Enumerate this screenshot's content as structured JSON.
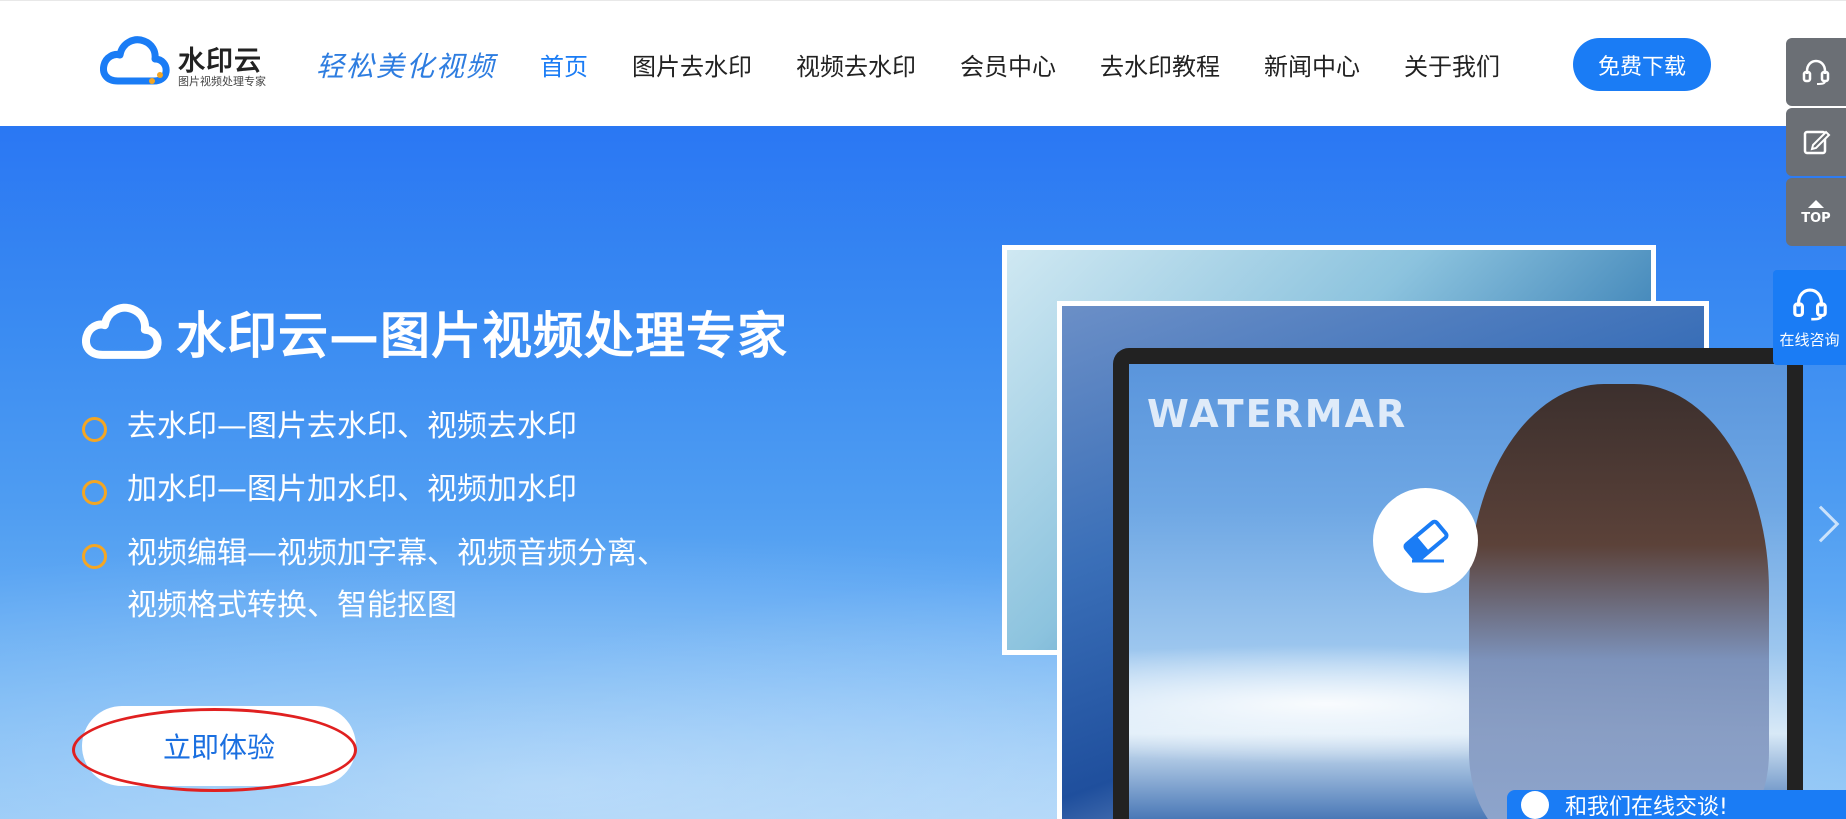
{
  "header": {
    "logo": {
      "name": "水印云",
      "subtitle": "图片视频处理专家"
    },
    "slogan": "轻松美化视频",
    "nav": [
      {
        "label": "首页",
        "active": true
      },
      {
        "label": "图片去水印",
        "active": false
      },
      {
        "label": "视频去水印",
        "active": false
      },
      {
        "label": "会员中心",
        "active": false
      },
      {
        "label": "去水印教程",
        "active": false
      },
      {
        "label": "新闻中心",
        "active": false
      },
      {
        "label": "关于我们",
        "active": false
      }
    ],
    "download_label": "免费下载"
  },
  "hero": {
    "title": "水印云—图片视频处理专家",
    "features": [
      {
        "lines": [
          "去水印—图片去水印、视频去水印"
        ]
      },
      {
        "lines": [
          "加水印—图片加水印、视频加水印"
        ]
      },
      {
        "lines": [
          "视频编辑—视频加字幕、视频音频分离、",
          "视频格式转换、智能抠图"
        ]
      }
    ],
    "cta_label": "立即体验",
    "watermark_text": "WATERMAR"
  },
  "side": {
    "top_label": "TOP",
    "consult_label": "在线咨询",
    "chat_label": "和我们在线交谈!"
  },
  "colors": {
    "brand": "#1a7cf5",
    "accent_ring": "#f4a623",
    "annotation": "#e02020"
  },
  "icons": [
    "cloud-logo-icon",
    "headset-icon",
    "edit-icon",
    "arrow-up-icon",
    "eraser-icon",
    "chat-icon",
    "chevron-right-icon"
  ]
}
